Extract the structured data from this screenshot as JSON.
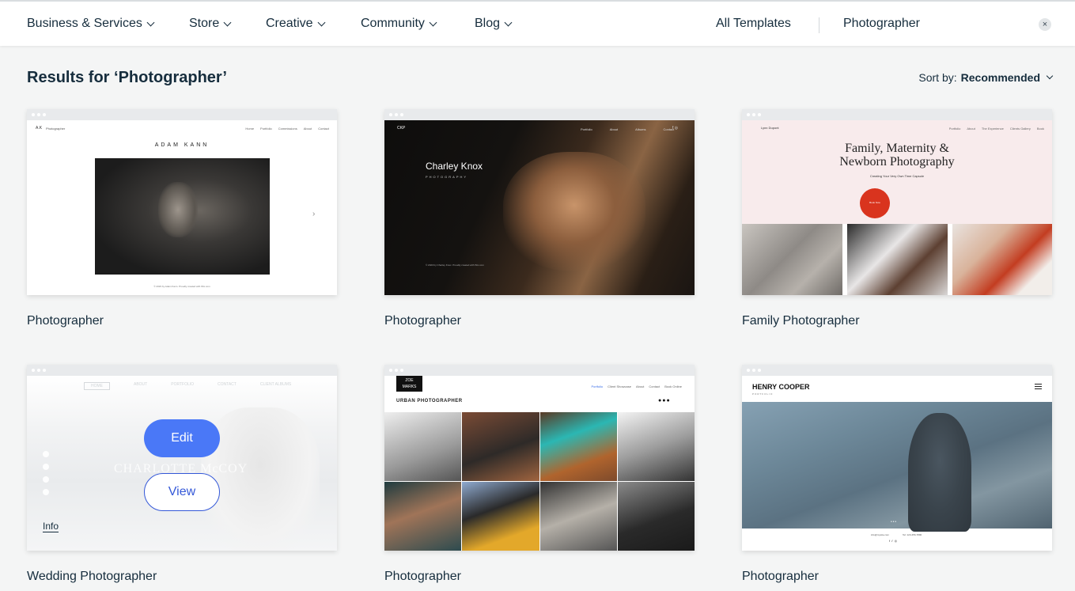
{
  "nav": {
    "items": [
      {
        "label": "Business & Services"
      },
      {
        "label": "Store"
      },
      {
        "label": "Creative"
      },
      {
        "label": "Community"
      },
      {
        "label": "Blog"
      }
    ],
    "all_templates": "All Templates",
    "search_value": "Photographer",
    "clear_icon": "×"
  },
  "results": {
    "title": "Results for ‘Photographer’",
    "sort_label": "Sort by:",
    "sort_value": "Recommended"
  },
  "cards": [
    {
      "title": "Photographer",
      "site": {
        "logo": "A.K",
        "tagline": "Photographer",
        "menu": [
          "Home",
          "Portfolio",
          "Commissions",
          "About",
          "Contact"
        ],
        "name": "ADAM KANN",
        "footer": "© 2023 by Adam Kann. Proudly created with Wix.com",
        "next_arrow": "›"
      }
    },
    {
      "title": "Photographer",
      "site": {
        "logo": "CKP",
        "menu": [
          "Portfolio",
          "About",
          "Albums",
          "Contact"
        ],
        "social": "f ◎",
        "name": "Charley Knox",
        "subtitle": "PHOTOGRAPHY",
        "footer": "© 2023 by Charley Knox. Proudly created with Wix.com"
      }
    },
    {
      "title": "Family Photographer",
      "site": {
        "logo": "Lynn Dupont",
        "menu": [
          "Portfolio",
          "About",
          "The Experience",
          "Clients Gallery",
          "Book"
        ],
        "headline_line1": "Family, Maternity &",
        "headline_line2": "Newborn Photography",
        "subtitle": "Creating Your Very Own Time Capsule",
        "button": "Book Now",
        "accent": "#d9341e"
      }
    },
    {
      "title": "Wedding Photographer",
      "site": {
        "menu": [
          "HOME",
          "ABOUT",
          "PORTFOLIO",
          "CONTACT",
          "CLIENT ALBUMS"
        ],
        "name": "CHARLOTTE McCOY"
      },
      "hover": {
        "edit": "Edit",
        "view": "View",
        "info": "Info"
      }
    },
    {
      "title": "Photographer",
      "site": {
        "logo_line1": "ZOE",
        "logo_line2": "MARKS",
        "menu": [
          "Portfolio",
          "Client Showcase",
          "About",
          "Contact",
          "Book Online"
        ],
        "subtitle": "URBAN PHOTOGRAPHER"
      }
    },
    {
      "title": "Photographer",
      "site": {
        "name": "HENRY COOPER",
        "subtitle": "PORTFOLIO",
        "email": "info@mysite.com",
        "phone": "Tel: 123-456-7890",
        "social": "f ✓ ◎",
        "dots": "● ● ●"
      }
    }
  ],
  "colors": {
    "primary_button": "#4a78f7",
    "link_blue": "#3458d8",
    "text": "#162d3d",
    "page_bg": "#f4f5f5"
  }
}
